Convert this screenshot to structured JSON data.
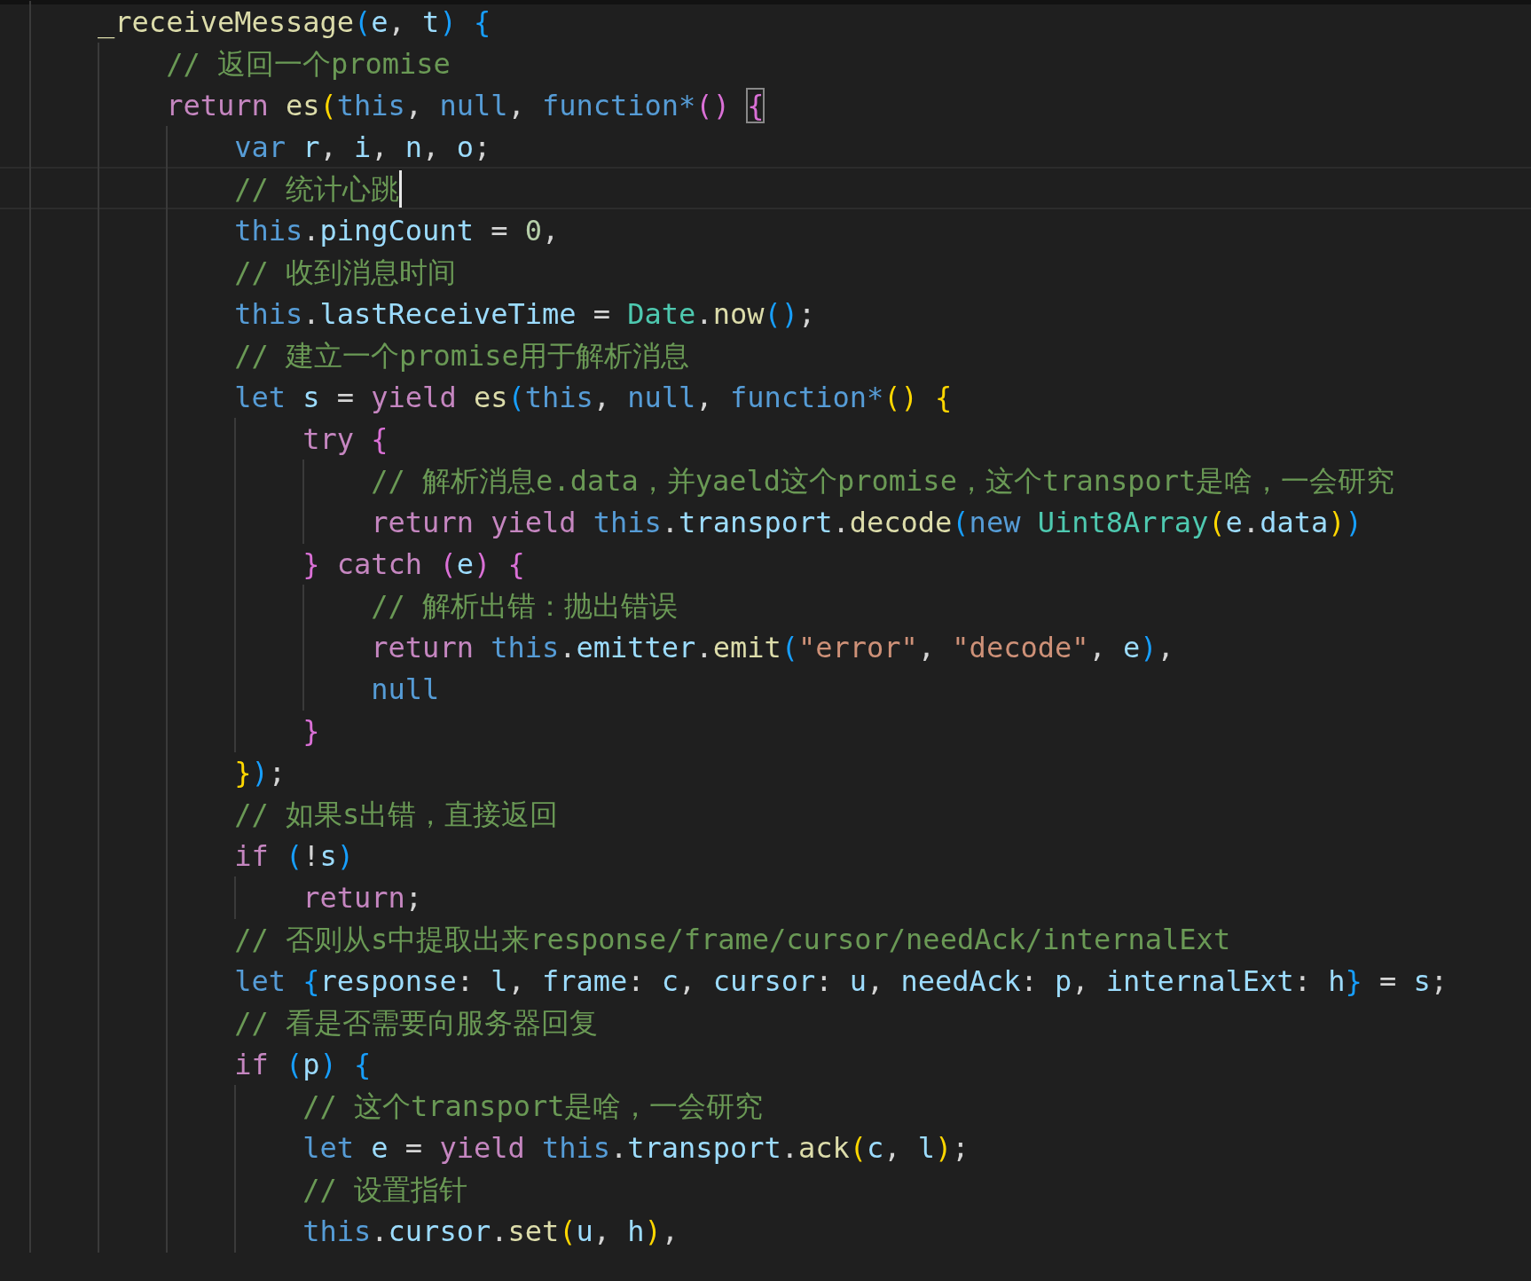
{
  "editor": {
    "lines": [
      {
        "current": false,
        "bracket_match": false,
        "tokens": [
          {
            "text": "_receiveMessage",
            "kind": "fn"
          },
          {
            "text": "(",
            "kind": "b3"
          },
          {
            "text": "e",
            "kind": "var"
          },
          {
            "text": ", ",
            "kind": "pl"
          },
          {
            "text": "t",
            "kind": "var"
          },
          {
            "text": ") ",
            "kind": "b3"
          },
          {
            "text": "{",
            "kind": "b3"
          }
        ],
        "children": [
          {
            "current": false,
            "bracket_match": false,
            "tokens": [
              {
                "text": "// 返回一个promise",
                "kind": "cm"
              }
            ]
          },
          {
            "current": false,
            "bracket_match": true,
            "tokens": [
              {
                "text": "return ",
                "kind": "kw"
              },
              {
                "text": "es",
                "kind": "fn"
              },
              {
                "text": "(",
                "kind": "b1"
              },
              {
                "text": "this",
                "kind": "st"
              },
              {
                "text": ", ",
                "kind": "pl"
              },
              {
                "text": "null",
                "kind": "st"
              },
              {
                "text": ", ",
                "kind": "pl"
              },
              {
                "text": "function*",
                "kind": "st"
              },
              {
                "text": "() ",
                "kind": "b2"
              },
              {
                "text": "{",
                "kind": "b2"
              }
            ],
            "children": [
              {
                "current": false,
                "bracket_match": false,
                "tokens": [
                  {
                    "text": "var ",
                    "kind": "st"
                  },
                  {
                    "text": "r",
                    "kind": "var"
                  },
                  {
                    "text": ", ",
                    "kind": "pl"
                  },
                  {
                    "text": "i",
                    "kind": "var"
                  },
                  {
                    "text": ", ",
                    "kind": "pl"
                  },
                  {
                    "text": "n",
                    "kind": "var"
                  },
                  {
                    "text": ", ",
                    "kind": "pl"
                  },
                  {
                    "text": "o",
                    "kind": "var"
                  },
                  {
                    "text": ";",
                    "kind": "pl"
                  }
                ]
              },
              {
                "current": true,
                "bracket_match": false,
                "tokens": [
                  {
                    "text": "// 统计心跳",
                    "kind": "cm"
                  }
                ]
              },
              {
                "current": false,
                "bracket_match": false,
                "tokens": [
                  {
                    "text": "this",
                    "kind": "st"
                  },
                  {
                    "text": ".",
                    "kind": "pl"
                  },
                  {
                    "text": "pingCount",
                    "kind": "var"
                  },
                  {
                    "text": " = ",
                    "kind": "pl"
                  },
                  {
                    "text": "0",
                    "kind": "num"
                  },
                  {
                    "text": ",",
                    "kind": "pl"
                  }
                ]
              },
              {
                "current": false,
                "bracket_match": false,
                "tokens": [
                  {
                    "text": "// 收到消息时间",
                    "kind": "cm"
                  }
                ]
              },
              {
                "current": false,
                "bracket_match": false,
                "tokens": [
                  {
                    "text": "this",
                    "kind": "st"
                  },
                  {
                    "text": ".",
                    "kind": "pl"
                  },
                  {
                    "text": "lastReceiveTime",
                    "kind": "var"
                  },
                  {
                    "text": " = ",
                    "kind": "pl"
                  },
                  {
                    "text": "Date",
                    "kind": "cls"
                  },
                  {
                    "text": ".",
                    "kind": "pl"
                  },
                  {
                    "text": "now",
                    "kind": "fn"
                  },
                  {
                    "text": "()",
                    "kind": "b3"
                  },
                  {
                    "text": ";",
                    "kind": "pl"
                  }
                ]
              },
              {
                "current": false,
                "bracket_match": false,
                "tokens": [
                  {
                    "text": "// 建立一个promise用于解析消息",
                    "kind": "cm"
                  }
                ]
              },
              {
                "current": false,
                "bracket_match": false,
                "tokens": [
                  {
                    "text": "let ",
                    "kind": "st"
                  },
                  {
                    "text": "s",
                    "kind": "var"
                  },
                  {
                    "text": " = ",
                    "kind": "pl"
                  },
                  {
                    "text": "yield ",
                    "kind": "kw"
                  },
                  {
                    "text": "es",
                    "kind": "fn"
                  },
                  {
                    "text": "(",
                    "kind": "b3"
                  },
                  {
                    "text": "this",
                    "kind": "st"
                  },
                  {
                    "text": ", ",
                    "kind": "pl"
                  },
                  {
                    "text": "null",
                    "kind": "st"
                  },
                  {
                    "text": ", ",
                    "kind": "pl"
                  },
                  {
                    "text": "function*",
                    "kind": "st"
                  },
                  {
                    "text": "() ",
                    "kind": "b1"
                  },
                  {
                    "text": "{",
                    "kind": "b1"
                  }
                ],
                "children": [
                  {
                    "current": false,
                    "bracket_match": false,
                    "tokens": [
                      {
                        "text": "try ",
                        "kind": "kw"
                      },
                      {
                        "text": "{",
                        "kind": "b2"
                      }
                    ],
                    "children": [
                      {
                        "current": false,
                        "bracket_match": false,
                        "tokens": [
                          {
                            "text": "// 解析消息e.data，并yaeld这个promise，这个transport是啥，一会研究",
                            "kind": "cm"
                          }
                        ]
                      },
                      {
                        "current": false,
                        "bracket_match": false,
                        "tokens": [
                          {
                            "text": "return ",
                            "kind": "kw"
                          },
                          {
                            "text": "yield ",
                            "kind": "kw"
                          },
                          {
                            "text": "this",
                            "kind": "st"
                          },
                          {
                            "text": ".",
                            "kind": "pl"
                          },
                          {
                            "text": "transport",
                            "kind": "var"
                          },
                          {
                            "text": ".",
                            "kind": "pl"
                          },
                          {
                            "text": "decode",
                            "kind": "fn"
                          },
                          {
                            "text": "(",
                            "kind": "b3"
                          },
                          {
                            "text": "new ",
                            "kind": "st"
                          },
                          {
                            "text": "Uint8Array",
                            "kind": "cls"
                          },
                          {
                            "text": "(",
                            "kind": "b1"
                          },
                          {
                            "text": "e",
                            "kind": "var"
                          },
                          {
                            "text": ".",
                            "kind": "pl"
                          },
                          {
                            "text": "data",
                            "kind": "var"
                          },
                          {
                            "text": ")",
                            "kind": "b1"
                          },
                          {
                            "text": ")",
                            "kind": "b3"
                          }
                        ]
                      }
                    ]
                  },
                  {
                    "current": false,
                    "bracket_match": false,
                    "tokens": [
                      {
                        "text": "} ",
                        "kind": "b2"
                      },
                      {
                        "text": "catch ",
                        "kind": "kw"
                      },
                      {
                        "text": "(",
                        "kind": "b2"
                      },
                      {
                        "text": "e",
                        "kind": "var"
                      },
                      {
                        "text": ") ",
                        "kind": "b2"
                      },
                      {
                        "text": "{",
                        "kind": "b2"
                      }
                    ],
                    "children": [
                      {
                        "current": false,
                        "bracket_match": false,
                        "tokens": [
                          {
                            "text": "// 解析出错：抛出错误",
                            "kind": "cm"
                          }
                        ]
                      },
                      {
                        "current": false,
                        "bracket_match": false,
                        "tokens": [
                          {
                            "text": "return ",
                            "kind": "kw"
                          },
                          {
                            "text": "this",
                            "kind": "st"
                          },
                          {
                            "text": ".",
                            "kind": "pl"
                          },
                          {
                            "text": "emitter",
                            "kind": "var"
                          },
                          {
                            "text": ".",
                            "kind": "pl"
                          },
                          {
                            "text": "emit",
                            "kind": "fn"
                          },
                          {
                            "text": "(",
                            "kind": "b3"
                          },
                          {
                            "text": "\"error\"",
                            "kind": "str"
                          },
                          {
                            "text": ", ",
                            "kind": "pl"
                          },
                          {
                            "text": "\"decode\"",
                            "kind": "str"
                          },
                          {
                            "text": ", ",
                            "kind": "pl"
                          },
                          {
                            "text": "e",
                            "kind": "var"
                          },
                          {
                            "text": ")",
                            "kind": "b3"
                          },
                          {
                            "text": ",",
                            "kind": "pl"
                          }
                        ]
                      },
                      {
                        "current": false,
                        "bracket_match": false,
                        "tokens": [
                          {
                            "text": "null",
                            "kind": "st"
                          }
                        ]
                      }
                    ]
                  },
                  {
                    "current": false,
                    "bracket_match": false,
                    "tokens": [
                      {
                        "text": "}",
                        "kind": "b2"
                      }
                    ]
                  }
                ]
              },
              {
                "current": false,
                "bracket_match": false,
                "tokens": [
                  {
                    "text": "}",
                    "kind": "b1"
                  },
                  {
                    "text": ")",
                    "kind": "b3"
                  },
                  {
                    "text": ";",
                    "kind": "pl"
                  }
                ]
              },
              {
                "current": false,
                "bracket_match": false,
                "tokens": [
                  {
                    "text": "// 如果s出错，直接返回",
                    "kind": "cm"
                  }
                ]
              },
              {
                "current": false,
                "bracket_match": false,
                "tokens": [
                  {
                    "text": "if ",
                    "kind": "kw"
                  },
                  {
                    "text": "(",
                    "kind": "b3"
                  },
                  {
                    "text": "!",
                    "kind": "pl"
                  },
                  {
                    "text": "s",
                    "kind": "var"
                  },
                  {
                    "text": ")",
                    "kind": "b3"
                  }
                ],
                "children": [
                  {
                    "current": false,
                    "bracket_match": false,
                    "tokens": [
                      {
                        "text": "return",
                        "kind": "kw"
                      },
                      {
                        "text": ";",
                        "kind": "pl"
                      }
                    ]
                  }
                ]
              },
              {
                "current": false,
                "bracket_match": false,
                "tokens": [
                  {
                    "text": "// 否则从s中提取出来response/frame/cursor/needAck/internalExt",
                    "kind": "cm"
                  }
                ]
              },
              {
                "current": false,
                "bracket_match": false,
                "tokens": [
                  {
                    "text": "let ",
                    "kind": "st"
                  },
                  {
                    "text": "{",
                    "kind": "b3"
                  },
                  {
                    "text": "response",
                    "kind": "var"
                  },
                  {
                    "text": ": ",
                    "kind": "pl"
                  },
                  {
                    "text": "l",
                    "kind": "var"
                  },
                  {
                    "text": ", ",
                    "kind": "pl"
                  },
                  {
                    "text": "frame",
                    "kind": "var"
                  },
                  {
                    "text": ": ",
                    "kind": "pl"
                  },
                  {
                    "text": "c",
                    "kind": "var"
                  },
                  {
                    "text": ", ",
                    "kind": "pl"
                  },
                  {
                    "text": "cursor",
                    "kind": "var"
                  },
                  {
                    "text": ": ",
                    "kind": "pl"
                  },
                  {
                    "text": "u",
                    "kind": "var"
                  },
                  {
                    "text": ", ",
                    "kind": "pl"
                  },
                  {
                    "text": "needAck",
                    "kind": "var"
                  },
                  {
                    "text": ": ",
                    "kind": "pl"
                  },
                  {
                    "text": "p",
                    "kind": "var"
                  },
                  {
                    "text": ", ",
                    "kind": "pl"
                  },
                  {
                    "text": "internalExt",
                    "kind": "var"
                  },
                  {
                    "text": ": ",
                    "kind": "pl"
                  },
                  {
                    "text": "h",
                    "kind": "var"
                  },
                  {
                    "text": "}",
                    "kind": "b3"
                  },
                  {
                    "text": " = ",
                    "kind": "pl"
                  },
                  {
                    "text": "s",
                    "kind": "var"
                  },
                  {
                    "text": ";",
                    "kind": "pl"
                  }
                ]
              },
              {
                "current": false,
                "bracket_match": false,
                "tokens": [
                  {
                    "text": "// 看是否需要向服务器回复",
                    "kind": "cm"
                  }
                ]
              },
              {
                "current": false,
                "bracket_match": false,
                "tokens": [
                  {
                    "text": "if ",
                    "kind": "kw"
                  },
                  {
                    "text": "(",
                    "kind": "b3"
                  },
                  {
                    "text": "p",
                    "kind": "var"
                  },
                  {
                    "text": ") ",
                    "kind": "b3"
                  },
                  {
                    "text": "{",
                    "kind": "b3"
                  }
                ],
                "children": [
                  {
                    "current": false,
                    "bracket_match": false,
                    "tokens": [
                      {
                        "text": "// 这个transport是啥，一会研究",
                        "kind": "cm"
                      }
                    ]
                  },
                  {
                    "current": false,
                    "bracket_match": false,
                    "tokens": [
                      {
                        "text": "let ",
                        "kind": "st"
                      },
                      {
                        "text": "e",
                        "kind": "var"
                      },
                      {
                        "text": " = ",
                        "kind": "pl"
                      },
                      {
                        "text": "yield ",
                        "kind": "kw"
                      },
                      {
                        "text": "this",
                        "kind": "st"
                      },
                      {
                        "text": ".",
                        "kind": "pl"
                      },
                      {
                        "text": "transport",
                        "kind": "var"
                      },
                      {
                        "text": ".",
                        "kind": "pl"
                      },
                      {
                        "text": "ack",
                        "kind": "fn"
                      },
                      {
                        "text": "(",
                        "kind": "b1"
                      },
                      {
                        "text": "c",
                        "kind": "var"
                      },
                      {
                        "text": ", ",
                        "kind": "pl"
                      },
                      {
                        "text": "l",
                        "kind": "var"
                      },
                      {
                        "text": ")",
                        "kind": "b1"
                      },
                      {
                        "text": ";",
                        "kind": "pl"
                      }
                    ]
                  },
                  {
                    "current": false,
                    "bracket_match": false,
                    "tokens": [
                      {
                        "text": "// 设置指针",
                        "kind": "cm"
                      }
                    ]
                  },
                  {
                    "current": false,
                    "bracket_match": false,
                    "tokens": [
                      {
                        "text": "this",
                        "kind": "st"
                      },
                      {
                        "text": ".",
                        "kind": "pl"
                      },
                      {
                        "text": "cursor",
                        "kind": "var"
                      },
                      {
                        "text": ".",
                        "kind": "pl"
                      },
                      {
                        "text": "set",
                        "kind": "fn"
                      },
                      {
                        "text": "(",
                        "kind": "b1"
                      },
                      {
                        "text": "u",
                        "kind": "var"
                      },
                      {
                        "text": ", ",
                        "kind": "pl"
                      },
                      {
                        "text": "h",
                        "kind": "var"
                      },
                      {
                        "text": ")",
                        "kind": "b1"
                      },
                      {
                        "text": ",",
                        "kind": "pl"
                      }
                    ]
                  }
                ]
              }
            ]
          }
        ]
      }
    ]
  }
}
